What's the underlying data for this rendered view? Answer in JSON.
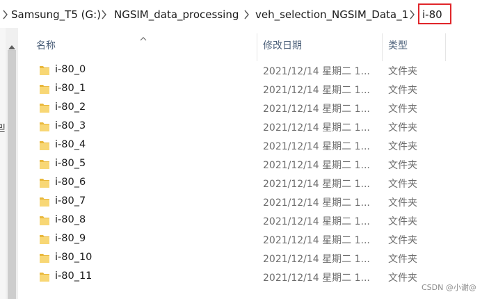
{
  "breadcrumb": {
    "items": [
      "Samsung_T5 (G:)",
      "NGSIM_data_processing",
      "veh_selection_NGSIM_Data_1",
      "i-80"
    ]
  },
  "columns": {
    "name": "名称",
    "date": "修改日期",
    "type": "类型"
  },
  "rows": [
    {
      "name": "i-80_0",
      "date": "2021/12/14 星期二 1...",
      "type": "文件夹"
    },
    {
      "name": "i-80_1",
      "date": "2021/12/14 星期二 1...",
      "type": "文件夹"
    },
    {
      "name": "i-80_2",
      "date": "2021/12/14 星期二 1...",
      "type": "文件夹"
    },
    {
      "name": "i-80_3",
      "date": "2021/12/14 星期二 1...",
      "type": "文件夹"
    },
    {
      "name": "i-80_4",
      "date": "2021/12/14 星期二 1...",
      "type": "文件夹"
    },
    {
      "name": "i-80_5",
      "date": "2021/12/14 星期二 1...",
      "type": "文件夹"
    },
    {
      "name": "i-80_6",
      "date": "2021/12/14 星期二 1...",
      "type": "文件夹"
    },
    {
      "name": "i-80_7",
      "date": "2021/12/14 星期二 1...",
      "type": "文件夹"
    },
    {
      "name": "i-80_8",
      "date": "2021/12/14 星期二 1...",
      "type": "文件夹"
    },
    {
      "name": "i-80_9",
      "date": "2021/12/14 星期二 1...",
      "type": "文件夹"
    },
    {
      "name": "i-80_10",
      "date": "2021/12/14 星期二 1...",
      "type": "文件夹"
    },
    {
      "name": "i-80_11",
      "date": "2021/12/14 星期二 1...",
      "type": "文件夹"
    }
  ],
  "left_edge_glyph": "믿",
  "watermark": "CSDN @小谢@",
  "colors": {
    "highlight_border": "#e0262a",
    "folder_yellow": "#f8d775",
    "header_text": "#4c607a",
    "meta_text": "#6d6d6d"
  },
  "icons": {
    "folder": "folder-icon",
    "separator": "chevron-right-icon",
    "sort": "sort-caret-up-icon",
    "scroll_up": "scroll-up-arrow-icon"
  }
}
